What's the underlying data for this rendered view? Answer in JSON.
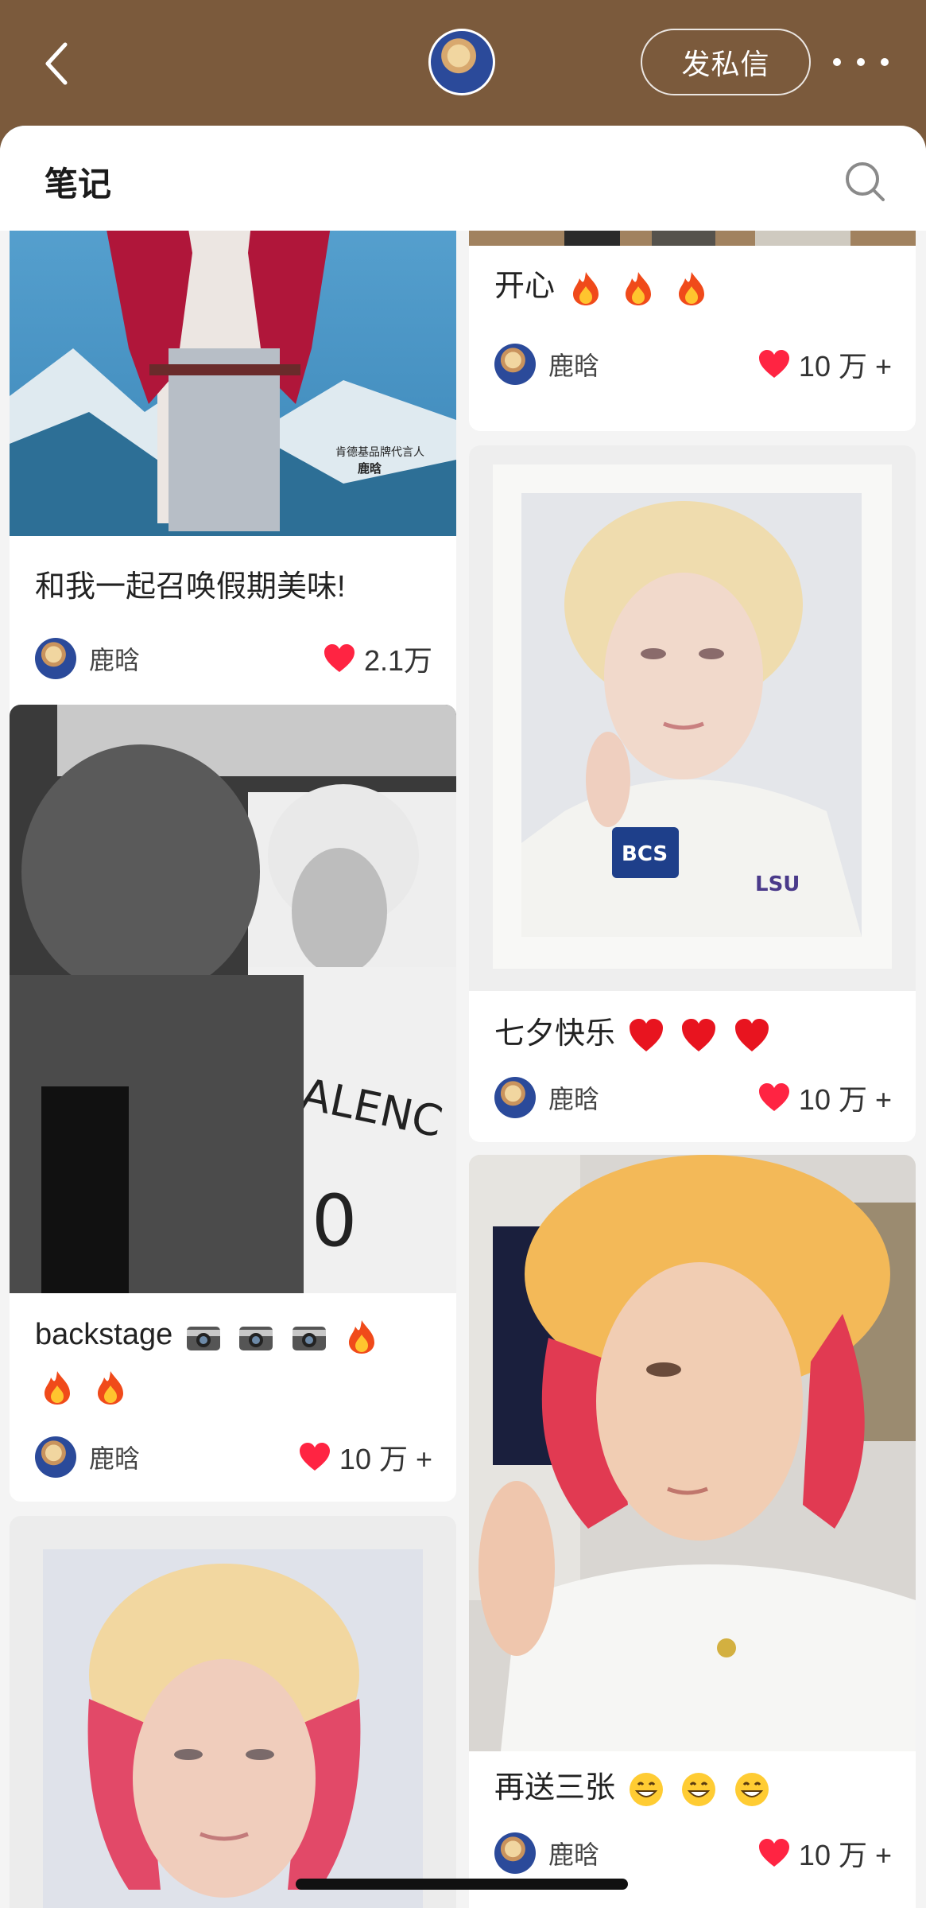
{
  "header": {
    "back_icon": "chevron-left-icon",
    "dm_label": "发私信",
    "more_icon": "more-dots-icon"
  },
  "section": {
    "title": "笔记",
    "search_icon": "search-icon"
  },
  "notes": [
    {
      "title": "和我一起召唤假期美味!",
      "author": "鹿晗",
      "likes": "2.1万"
    },
    {
      "title": "开心",
      "emoji": "fire-emoji",
      "author": "鹿晗",
      "likes": "10 万 +"
    },
    {
      "title": "backstage",
      "emoji": "camera-emoji fire-emoji",
      "author": "鹿晗",
      "likes": "10 万 +"
    },
    {
      "title": "七夕快乐",
      "emoji": "heart-emoji",
      "author": "鹿晗",
      "likes": "10 万 +"
    },
    {
      "title": "再送三张",
      "emoji": "grin-emoji",
      "author": "鹿晗",
      "likes": "10 万 +"
    },
    {
      "title": "",
      "author": "",
      "likes": ""
    }
  ],
  "photo_texts": {
    "ad_caption": "肯德基品牌代言人",
    "ad_name": "鹿晗"
  },
  "colors": {
    "header_bg": "#7b5a3c",
    "like_heart": "#ff2442",
    "page_bg": "#f4f4f4"
  }
}
